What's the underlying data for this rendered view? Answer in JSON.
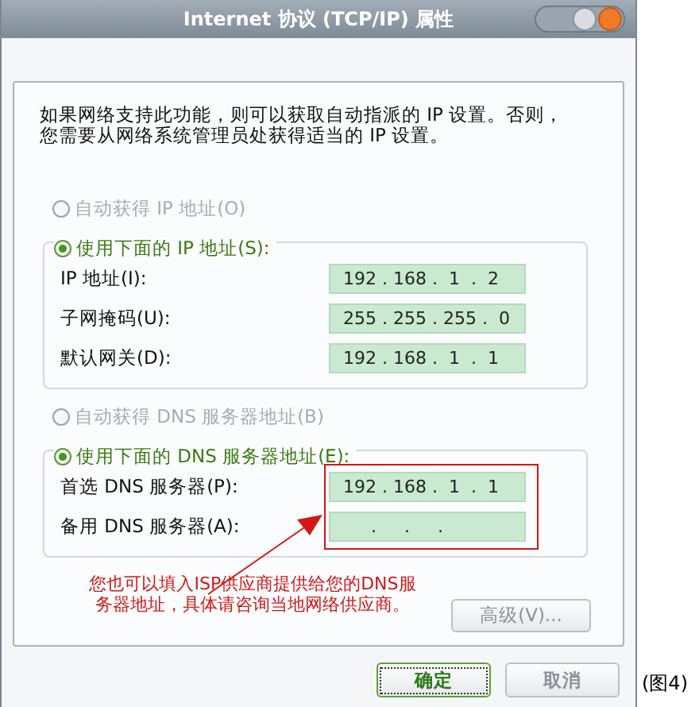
{
  "window": {
    "title": "Internet 协议 (TCP/IP) 属性"
  },
  "description_lines": [
    "如果网络支持此功能，则可以获取自动指派的 IP 设置。否则，",
    "您需要从网络系统管理员处获得适当的 IP 设置。"
  ],
  "ip_section": {
    "options": [
      {
        "label": "自动获得 IP 地址(O)",
        "selected": false,
        "disabled": true
      },
      {
        "label": "使用下面的 IP 地址(S):",
        "selected": true,
        "disabled": false
      }
    ],
    "fields": [
      {
        "label": "IP 地址(I):",
        "value": "192 . 168 .  1  .  2"
      },
      {
        "label": "子网掩码(U):",
        "value": "255 . 255 . 255 .  0"
      },
      {
        "label": "默认网关(D):",
        "value": "192 . 168 .  1  .  1"
      }
    ]
  },
  "dns_section": {
    "options": [
      {
        "label": "自动获得 DNS 服务器地址(B)",
        "selected": false,
        "disabled": true
      },
      {
        "label": "使用下面的 DNS 服务器地址(E):",
        "selected": true,
        "disabled": false
      }
    ],
    "fields": [
      {
        "label": "首选 DNS 服务器(P):",
        "value": "192 . 168 .  1  .  1"
      },
      {
        "label": "备用 DNS 服务器(A):",
        "value": "     .     .     ."
      }
    ]
  },
  "advanced_button": "高级(V)...",
  "annotation": {
    "lines": [
      "您也可以填入ISP供应商提供给您的DNS服",
      "务器地址，具体请咨询当地网络供应商。"
    ]
  },
  "dialog_buttons": [
    {
      "label": "确定",
      "default": true
    },
    {
      "label": "取消",
      "default": false
    }
  ],
  "caption": "(图4)"
}
